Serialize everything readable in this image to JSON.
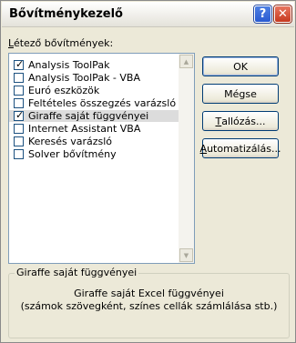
{
  "window": {
    "title": "Bővítménykezelő",
    "help_glyph": "?",
    "close_glyph": "✕"
  },
  "list": {
    "label_prefix": "L",
    "label_rest": "étező bővítmények:",
    "items": [
      {
        "label": "Analysis ToolPak",
        "checked": true
      },
      {
        "label": "Analysis ToolPak - VBA",
        "checked": false
      },
      {
        "label": "Euró eszközök",
        "checked": false
      },
      {
        "label": "Feltételes összegzés varázsló",
        "checked": false
      },
      {
        "label": "Giraffe saját függvényei",
        "checked": true,
        "selected": true
      },
      {
        "label": "Internet Assistant VBA",
        "checked": false
      },
      {
        "label": "Keresés varázsló",
        "checked": false
      },
      {
        "label": "Solver bővítmény",
        "checked": false
      }
    ]
  },
  "buttons": {
    "ok": "OK",
    "cancel": "Mégse",
    "browse_prefix": "T",
    "browse_rest": "allózás...",
    "automation_prefix": "A",
    "automation_rest": "utomatizálás..."
  },
  "description": {
    "group_title": "Giraffe saját függvényei",
    "line1": "Giraffe saját Excel függvényei",
    "line2": "(számok szövegként, színes cellák számlálása stb.)"
  }
}
